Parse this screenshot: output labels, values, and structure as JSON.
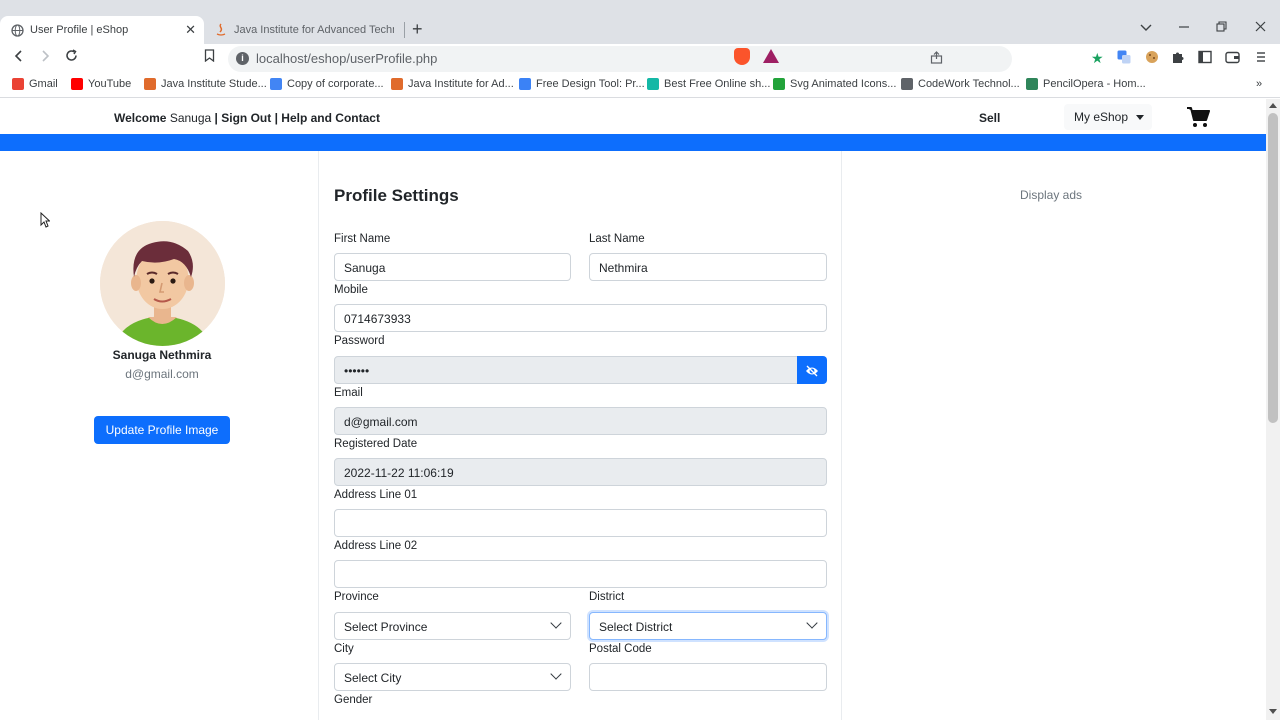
{
  "browser": {
    "tabs": [
      {
        "title": "User Profile | eShop",
        "active": true
      },
      {
        "title": "Java Institute for Advanced Technolog",
        "active": false
      }
    ],
    "url": "localhost/eshop/userProfile.php",
    "bookmarks": [
      {
        "label": "Gmail",
        "color": "#ea4335"
      },
      {
        "label": "YouTube",
        "color": "#ff0000"
      },
      {
        "label": "Java Institute Stude...",
        "color": "#e06b2c"
      },
      {
        "label": "Copy of corporate...",
        "color": "#4285f4"
      },
      {
        "label": "Java Institute for Ad...",
        "color": "#e06b2c"
      },
      {
        "label": "Free Design Tool: Pr...",
        "color": "#3b82f6"
      },
      {
        "label": "Best Free Online sh...",
        "color": "#14b8a6"
      },
      {
        "label": "Svg Animated Icons...",
        "color": "#22a33a"
      },
      {
        "label": "CodeWork Technol...",
        "color": "#5f6368"
      },
      {
        "label": "PencilOpera - Hom...",
        "color": "#2f855a"
      }
    ]
  },
  "nav": {
    "welcome_label": "Welcome",
    "username": "Sanuga",
    "sep1": "|",
    "sign_out": "Sign Out",
    "sep2": "|",
    "help": "Help and Contact",
    "sell": "Sell",
    "my_eshop": "My eShop",
    "brand_color": "#0d6efd"
  },
  "profile": {
    "name": "Sanuga Nethmira",
    "email": "d@gmail.com",
    "update_button": "Update Profile Image"
  },
  "form": {
    "title": "Profile Settings",
    "first_name_label": "First Name",
    "first_name": "Sanuga",
    "last_name_label": "Last Name",
    "last_name": "Nethmira",
    "mobile_label": "Mobile",
    "mobile": "0714673933",
    "password_label": "Password",
    "password": "••••••",
    "email_label": "Email",
    "email": "d@gmail.com",
    "registered_label": "Registered Date",
    "registered": "2022-11-22 11:06:19",
    "address1_label": "Address Line 01",
    "address1": "",
    "address2_label": "Address Line 02",
    "address2": "",
    "province_label": "Province",
    "province": "Select Province",
    "district_label": "District",
    "district": "Select District",
    "city_label": "City",
    "city": "Select City",
    "postal_label": "Postal Code",
    "postal": "",
    "gender_label": "Gender"
  },
  "ads": {
    "label": "Display ads"
  }
}
